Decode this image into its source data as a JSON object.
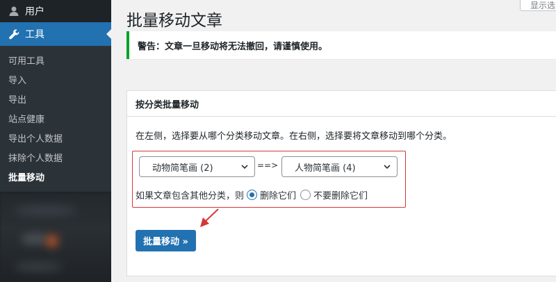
{
  "sidebar": {
    "users_label": "用户",
    "tools_label": "工具",
    "submenu": [
      {
        "label": "可用工具"
      },
      {
        "label": "导入"
      },
      {
        "label": "导出"
      },
      {
        "label": "站点健康"
      },
      {
        "label": "导出个人数据"
      },
      {
        "label": "抹除个人数据"
      },
      {
        "label": "批量移动"
      }
    ],
    "icons": {
      "users": "user-icon",
      "tools": "wrench-icon"
    }
  },
  "header": {
    "screen_options_label": "显示选",
    "page_title": "批量移动文章"
  },
  "notice": {
    "text": "警告：文章一旦移动将无法撤回，请谨慎使用。"
  },
  "panel": {
    "title": "按分类批量移动",
    "description": "在左侧，选择要从哪个分类移动文章。在右侧，选择要将文章移动到哪个分类。",
    "from_select": "动物简笔画  (2)",
    "arrow_text": "==>",
    "to_select": "人物简笔画  (4)",
    "other_category_label": "如果文章包含其他分类，则",
    "option_delete": "删除它们",
    "option_keep": "不要删除它们",
    "selected_option": "delete",
    "submit_label": "批量移动 »"
  },
  "colors": {
    "accent": "#2271b1",
    "sidebar_bg": "#1d2327",
    "notice_success": "#00a32a",
    "annotation_red": "#d63638"
  }
}
